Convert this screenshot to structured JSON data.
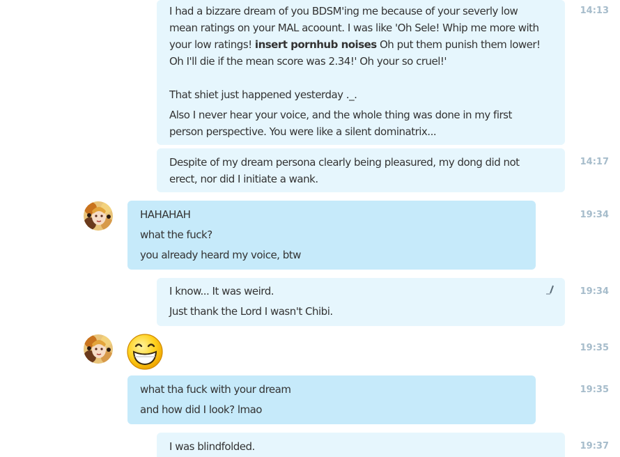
{
  "messages": [
    {
      "time": "14:13",
      "line1": "I had a bizzare dream of you BDSM'ing me because of your severly low",
      "line2": "mean ratings on your MAL acoount. I was like 'Oh Sele! Whip me more with",
      "line3_before": "your low ratings! ",
      "line3_bold": "insert pornhub noises",
      "line3_after": " Oh put them punish them lower!",
      "line4": "Oh I'll die if the mean score was 2.34!' Oh your so cruel!'",
      "line5": "That shiet just happened yesterday ._.",
      "line6": "Also I never hear your voice, and the whole thing was done in my first",
      "line7": "person perspective. You were like a silent dominatrix..."
    },
    {
      "time": "14:17",
      "line1": "Despite of my dream persona clearly being pleasured, my dong did not",
      "line2": "erect, nor did I initiate a wank."
    },
    {
      "time": "19:34",
      "line1": "HAHAHAH",
      "line2": "what the fuck?",
      "line3": "you already heard my voice, btw"
    },
    {
      "time": "19:34",
      "line1": "I know... It was weird.",
      "line2": "Just thank the Lord I wasn't Chibi."
    },
    {
      "time": "19:35",
      "emoticon": "big-smile-emoticon"
    },
    {
      "time": "19:35",
      "line1": "what tha fuck with your dream",
      "line2": "and how did I look? lmao"
    },
    {
      "time": "19:37",
      "line1": "I was blindfolded."
    }
  ],
  "colors": {
    "own_bubble": "#e6f6fd",
    "other_bubble": "#c6eafa",
    "timestamp": "#a6bccb",
    "text": "#333333"
  },
  "icons": {
    "avatar": "contact-avatar",
    "edit": "pencil-edit-icon"
  }
}
